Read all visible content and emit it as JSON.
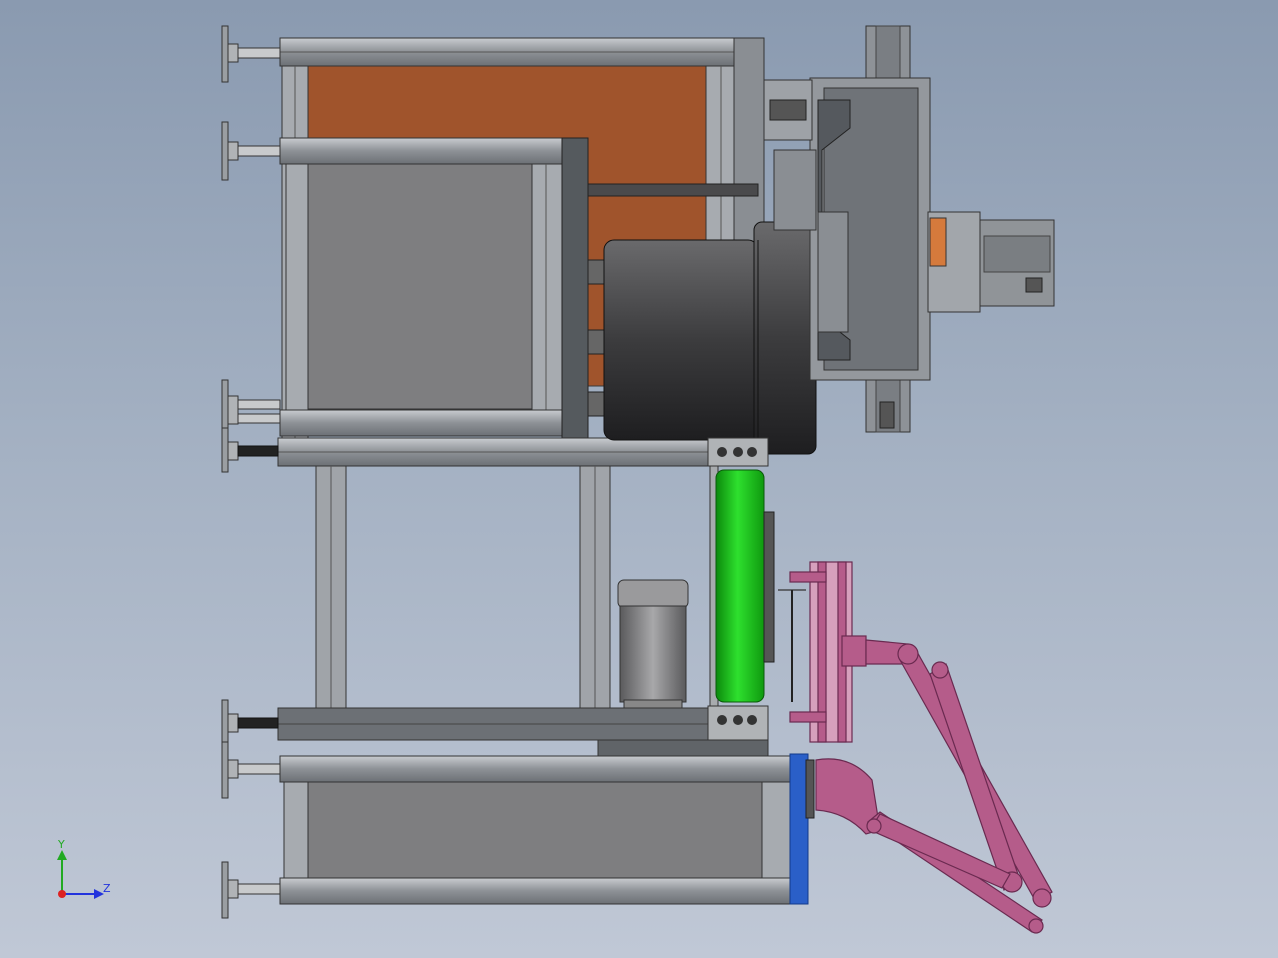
{
  "viewport": {
    "background_top": "#8a9ab0",
    "background_bottom": "#c0c8d6"
  },
  "triad": {
    "y_label": "Y",
    "z_label": "Z",
    "y_color": "#22aa22",
    "z_color": "#2233dd",
    "x_color": "#dd2222"
  },
  "colors": {
    "frame": "#9a9ea3",
    "frame_dark": "#5e6266",
    "panel_orange": "#a0542c",
    "panel_grey": "#7e7e80",
    "motor_dark": "#3a3a3c",
    "roller_green": "#1fcc1f",
    "arm_pink": "#b55c8a",
    "plate_blue": "#2a5fc8"
  }
}
